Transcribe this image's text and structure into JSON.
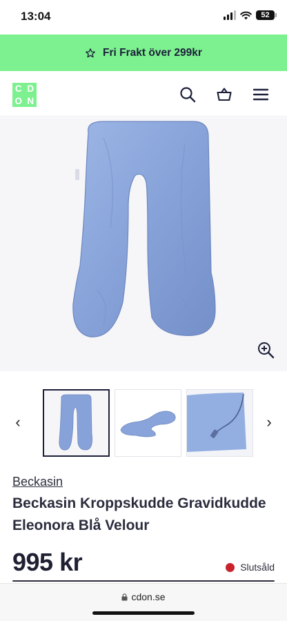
{
  "status_bar": {
    "time": "13:04",
    "battery": "52"
  },
  "promo": {
    "text": "Fri Frakt över 299kr",
    "icon": "star-outline-icon"
  },
  "header": {
    "logo_letters": [
      "C",
      "D",
      "O",
      "N"
    ],
    "icons": [
      "search-icon",
      "basket-icon",
      "menu-icon"
    ]
  },
  "gallery": {
    "main_image": "blue-u-shaped-body-pillow",
    "zoom_icon": "zoom-in-icon",
    "thumbnails": [
      {
        "image": "pillow-front-view",
        "selected": true
      },
      {
        "image": "pillow-lying-flat",
        "selected": false
      },
      {
        "image": "pillow-zipper-closeup",
        "selected": false
      }
    ]
  },
  "product": {
    "brand": "Beckasin",
    "title": "Beckasin Kroppskudde Gravidkud­de Eleonora Blå Velour",
    "price": "995 kr",
    "stock_status": "Slutsåld"
  },
  "browser": {
    "url": "cdon.se"
  },
  "colors": {
    "brand_green": "#7df08f",
    "dark_navy": "#1c1f3a",
    "sold_out_red": "#c8232c",
    "pillow_blue": "#8aa6dc"
  }
}
